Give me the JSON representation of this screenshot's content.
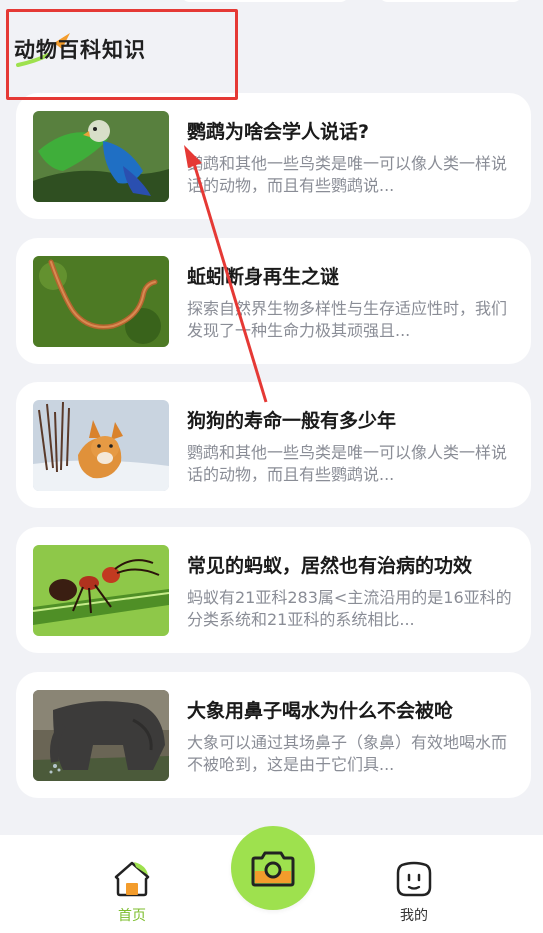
{
  "section": {
    "title": "动物百科知识"
  },
  "articles": [
    {
      "title": "鹦鹉为啥会学人说话?",
      "desc": "鹦鹉和其他一些鸟类是唯一可以像人类一样说话的动物，而且有些鹦鹉说...",
      "image": "parrot"
    },
    {
      "title": "蚯蚓断身再生之谜",
      "desc": "探索自然界生物多样性与生存适应性时，我们发现了一种生命力极其顽强且...",
      "image": "earthworm"
    },
    {
      "title": "狗狗的寿命一般有多少年",
      "desc": "鹦鹉和其他一些鸟类是唯一可以像人类一样说话的动物，而且有些鹦鹉说...",
      "image": "dog-in-snow"
    },
    {
      "title": "常见的蚂蚁，居然也有治病的功效",
      "desc": "蚂蚁有21亚科283属<主流沿用的是16亚科的分类系统和21亚科的系统相比...",
      "image": "ant"
    },
    {
      "title": "大象用鼻子喝水为什么不会被呛",
      "desc": "大象可以通过其场鼻子（象鼻）有效地喝水而不被呛到，这是由于它们具...",
      "image": "elephant"
    }
  ],
  "tabbar": {
    "home_label": "首页",
    "mine_label": "我的",
    "home_icon": "home-icon",
    "camera_icon": "camera-icon",
    "mine_icon": "face-icon"
  },
  "colors": {
    "accent": "#9ee14e",
    "active_tab": "#7dbe2e",
    "highlight_box": "#e53935",
    "background": "#f1f2f6"
  }
}
